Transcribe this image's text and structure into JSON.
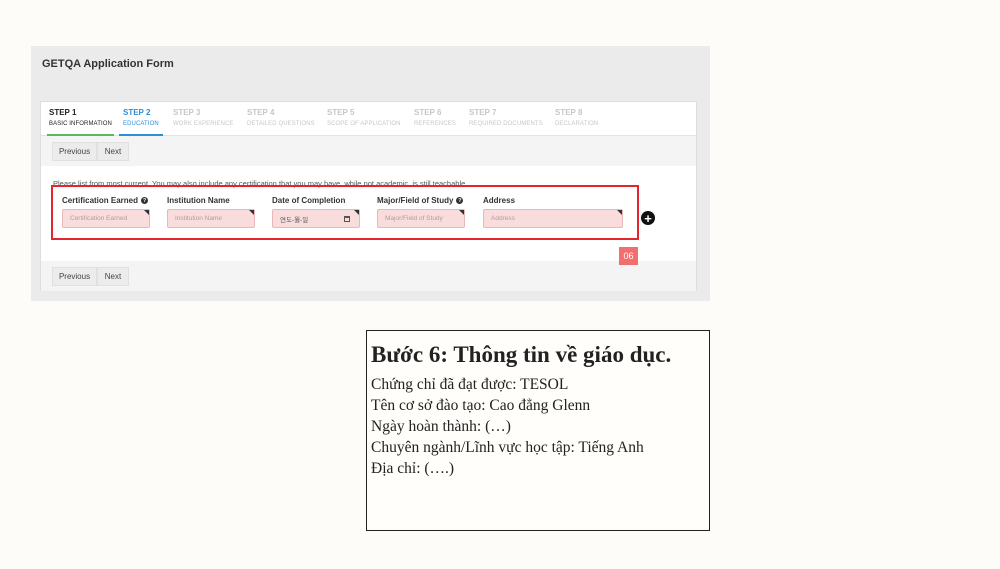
{
  "form": {
    "title": "GETQA Application Form"
  },
  "steps": [
    {
      "num": "STEP 1",
      "label": "BASIC INFORMATION"
    },
    {
      "num": "STEP 2",
      "label": "EDUCATION"
    },
    {
      "num": "STEP 3",
      "label": "WORK EXPERIENCE"
    },
    {
      "num": "STEP 4",
      "label": "DETAILED QUESTIONS"
    },
    {
      "num": "STEP 5",
      "label": "SCOPE OF APPLICATION"
    },
    {
      "num": "STEP 6",
      "label": "REFERENCES"
    },
    {
      "num": "STEP 7",
      "label": "REQUIRED DOCUMENTS"
    },
    {
      "num": "STEP 8",
      "label": "DECLARATION"
    }
  ],
  "nav": {
    "previous": "Previous",
    "next": "Next"
  },
  "hint": "Please list from most current. You may also include any certification that you may have, while not academic, is still teachable.",
  "fields": {
    "certification": {
      "label": "Certification Earned",
      "placeholder": "Certification Earned"
    },
    "institution": {
      "label": "Institution Name",
      "placeholder": "Institution Name"
    },
    "date": {
      "label": "Date of Completion",
      "placeholder": "연도-월-일"
    },
    "major": {
      "label": "Major/Field of Study",
      "placeholder": "Major/Field of Study"
    },
    "address": {
      "label": "Address",
      "placeholder": "Address"
    }
  },
  "badge": "06",
  "icons": {
    "add": "plus-circle-icon",
    "help": "question-circle-icon",
    "calendar": "calendar-icon"
  },
  "colors": {
    "highlight": "#e3262d",
    "active_step": "#2b8fd6",
    "done_step": "#5cb85c",
    "badge": "#f26f6f",
    "input_bg": "#f9dcdc"
  },
  "note": {
    "title": "Bước 6: Thông tin về giáo dục.",
    "lines": [
      "Chứng chỉ đã đạt được: TESOL",
      "Tên cơ sở đào tạo: Cao đẳng Glenn",
      "Ngày hoàn thành: (…)",
      "Chuyên ngành/Lĩnh vực học tập: Tiếng Anh",
      "Địa chỉ: (….)"
    ]
  }
}
